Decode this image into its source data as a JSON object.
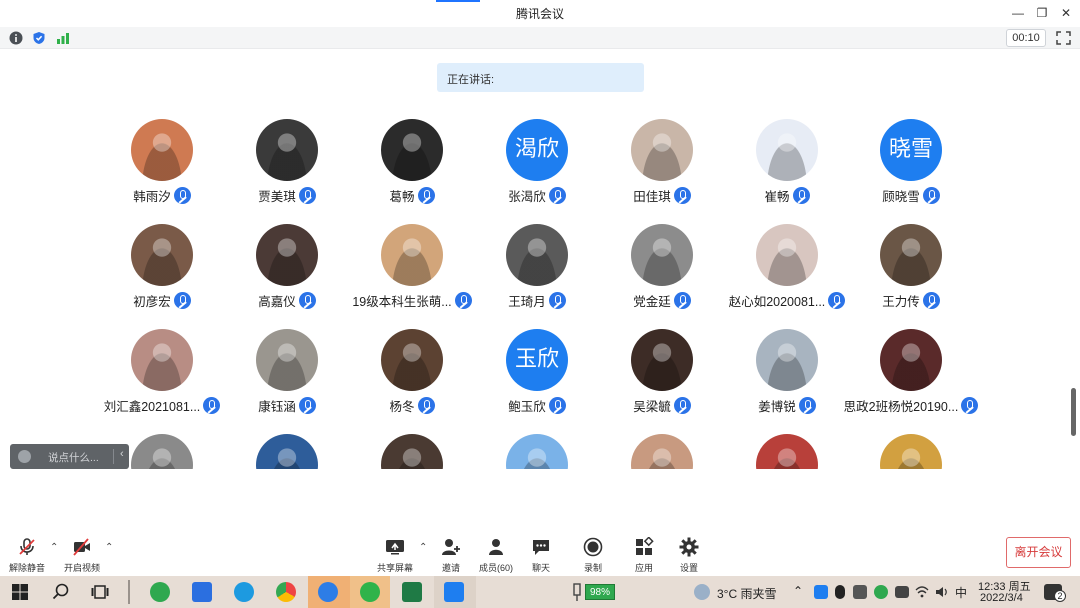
{
  "window": {
    "title": "腾讯会议",
    "controls": [
      "—",
      "❐",
      "✕"
    ]
  },
  "infobar": {
    "timer": "00:10"
  },
  "speaking": {
    "label": "正在讲话:"
  },
  "participants": [
    {
      "name": "韩雨汐",
      "avatar": "photo",
      "color": "#cf7a52"
    },
    {
      "name": "贾美琪",
      "avatar": "photo",
      "color": "#3a3a3a"
    },
    {
      "name": "葛畅",
      "avatar": "photo",
      "color": "#2b2b2b"
    },
    {
      "name": "张渴欣",
      "avatar": "text",
      "avatar_text": "渴欣"
    },
    {
      "name": "田佳琪",
      "avatar": "photo",
      "color": "#c9b6a8"
    },
    {
      "name": "崔畅",
      "avatar": "photo",
      "color": "#e7ecf5"
    },
    {
      "name": "顾晓雪",
      "avatar": "text",
      "avatar_text": "晓雪"
    },
    {
      "name": "初彦宏",
      "avatar": "photo",
      "color": "#7a5a48"
    },
    {
      "name": "高嘉仪",
      "avatar": "photo",
      "color": "#4b3a36"
    },
    {
      "name": "19级本科生张萌...",
      "avatar": "photo",
      "color": "#d2a57a"
    },
    {
      "name": "王琦月",
      "avatar": "photo",
      "color": "#5a5a5a"
    },
    {
      "name": "党金廷",
      "avatar": "photo",
      "color": "#8c8c8c"
    },
    {
      "name": "赵心如2020081...",
      "avatar": "photo",
      "color": "#d8c6c0"
    },
    {
      "name": "王力传",
      "avatar": "photo",
      "color": "#6a5646"
    },
    {
      "name": "刘汇鑫2021081...",
      "avatar": "photo",
      "color": "#b88d84"
    },
    {
      "name": "康钰涵",
      "avatar": "photo",
      "color": "#9a968f"
    },
    {
      "name": "杨冬",
      "avatar": "photo",
      "color": "#5c4232"
    },
    {
      "name": "鲍玉欣",
      "avatar": "text",
      "avatar_text": "玉欣"
    },
    {
      "name": "吴梁毓",
      "avatar": "photo",
      "color": "#3d2c26"
    },
    {
      "name": "姜博锐",
      "avatar": "photo",
      "color": "#a8b4c0"
    },
    {
      "name": "思政2班杨悦20190...",
      "avatar": "photo",
      "color": "#5a2a2a"
    },
    {
      "name": "",
      "avatar": "photo",
      "color": "#8a8a8a"
    },
    {
      "name": "",
      "avatar": "photo",
      "color": "#2e5d9a"
    },
    {
      "name": "",
      "avatar": "photo",
      "color": "#4a3a32"
    },
    {
      "name": "",
      "avatar": "photo",
      "color": "#7ab2e8"
    },
    {
      "name": "",
      "avatar": "photo",
      "color": "#c89a80"
    },
    {
      "name": "",
      "avatar": "photo",
      "color": "#b8403a"
    },
    {
      "name": "",
      "avatar": "photo",
      "color": "#d2a040"
    }
  ],
  "chat": {
    "placeholder": "说点什么..."
  },
  "toolbar": {
    "unmute": "解除静音",
    "start_video": "开启视频",
    "share_screen": "共享屏幕",
    "invite": "邀请",
    "members": "成员(60)",
    "chat": "聊天",
    "record": "录制",
    "apps": "应用",
    "settings": "设置",
    "leave": "离开会议"
  },
  "taskbar": {
    "battery": "98%",
    "weather": "3°C  雨夹雪",
    "ime": "中",
    "time": "12:33 周五",
    "date": "2022/3/4",
    "notification_count": "2"
  },
  "colors": {
    "accent": "#1e7ef0",
    "mic_badge": "#2b73e8",
    "leave": "#d63b3b",
    "taskbar_bg": "#e7ddd5"
  }
}
